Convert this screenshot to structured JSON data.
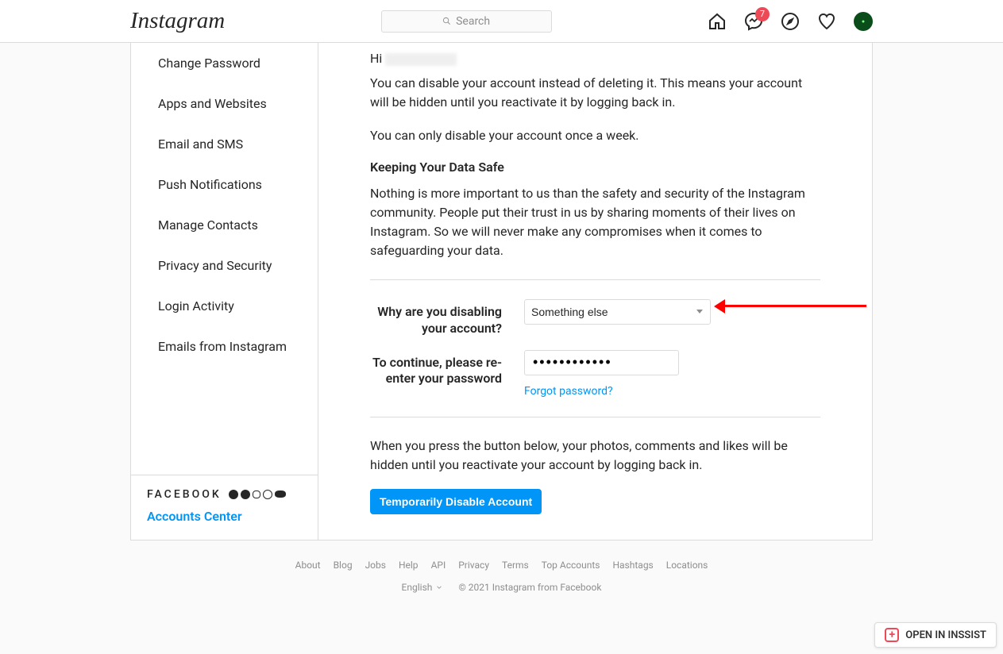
{
  "header": {
    "logo": "Instagram",
    "search_placeholder": "Search",
    "badge_count": "7"
  },
  "sidebar": {
    "items": [
      {
        "label": "Change Password"
      },
      {
        "label": "Apps and Websites"
      },
      {
        "label": "Email and SMS"
      },
      {
        "label": "Push Notifications"
      },
      {
        "label": "Manage Contacts"
      },
      {
        "label": "Privacy and Security"
      },
      {
        "label": "Login Activity"
      },
      {
        "label": "Emails from Instagram"
      }
    ],
    "footer_brand": "FACEBOOK",
    "accounts_center": "Accounts Center"
  },
  "main": {
    "greeting": "Hi",
    "para1": "You can disable your account instead of deleting it. This means your account will be hidden until you reactivate it by logging back in.",
    "para2": "You can only disable your account once a week.",
    "section_title": "Keeping Your Data Safe",
    "para3": "Nothing is more important to us than the safety and security of the Instagram community. People put their trust in us by sharing moments of their lives on Instagram. So we will never make any compromises when it comes to safeguarding your data.",
    "reason_label": "Why are you disabling your account?",
    "reason_value": "Something else",
    "password_label": "To continue, please re-enter your password",
    "password_value": "••••••••••••",
    "forgot_password": "Forgot password?",
    "para4": "When you press the button below, your photos, comments and likes will be hidden until you reactivate your account by logging back in.",
    "submit_label": "Temporarily Disable Account"
  },
  "footer": {
    "links": [
      "About",
      "Blog",
      "Jobs",
      "Help",
      "API",
      "Privacy",
      "Terms",
      "Top Accounts",
      "Hashtags",
      "Locations"
    ],
    "language": "English",
    "copyright": "© 2021 Instagram from Facebook"
  },
  "inssist": {
    "label": "OPEN IN INSSIST"
  }
}
